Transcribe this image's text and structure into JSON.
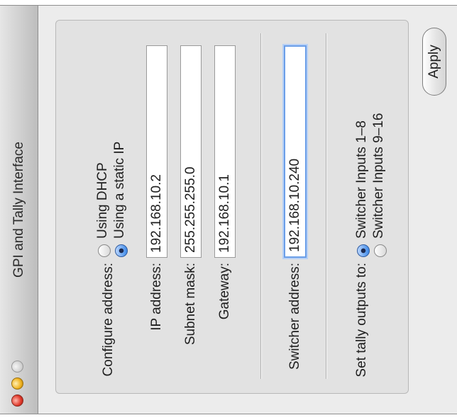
{
  "window": {
    "title": "GPI and Tally Interface"
  },
  "configure": {
    "label": "Configure address:",
    "options": [
      {
        "label": "Using DHCP",
        "selected": false
      },
      {
        "label": "Using a static IP",
        "selected": true
      }
    ]
  },
  "network": {
    "ip_label": "IP address:",
    "ip_value": "192.168.10.2",
    "subnet_label": "Subnet mask:",
    "subnet_value": "255.255.255.0",
    "gateway_label": "Gateway:",
    "gateway_value": "192.168.10.1"
  },
  "switcher": {
    "label": "Switcher address:",
    "value": "192.168.10.240"
  },
  "tally": {
    "label": "Set tally outputs to:",
    "options": [
      {
        "label": "Switcher Inputs 1–8",
        "selected": true
      },
      {
        "label": "Switcher Inputs 9–16",
        "selected": false
      }
    ]
  },
  "apply_label": "Apply"
}
